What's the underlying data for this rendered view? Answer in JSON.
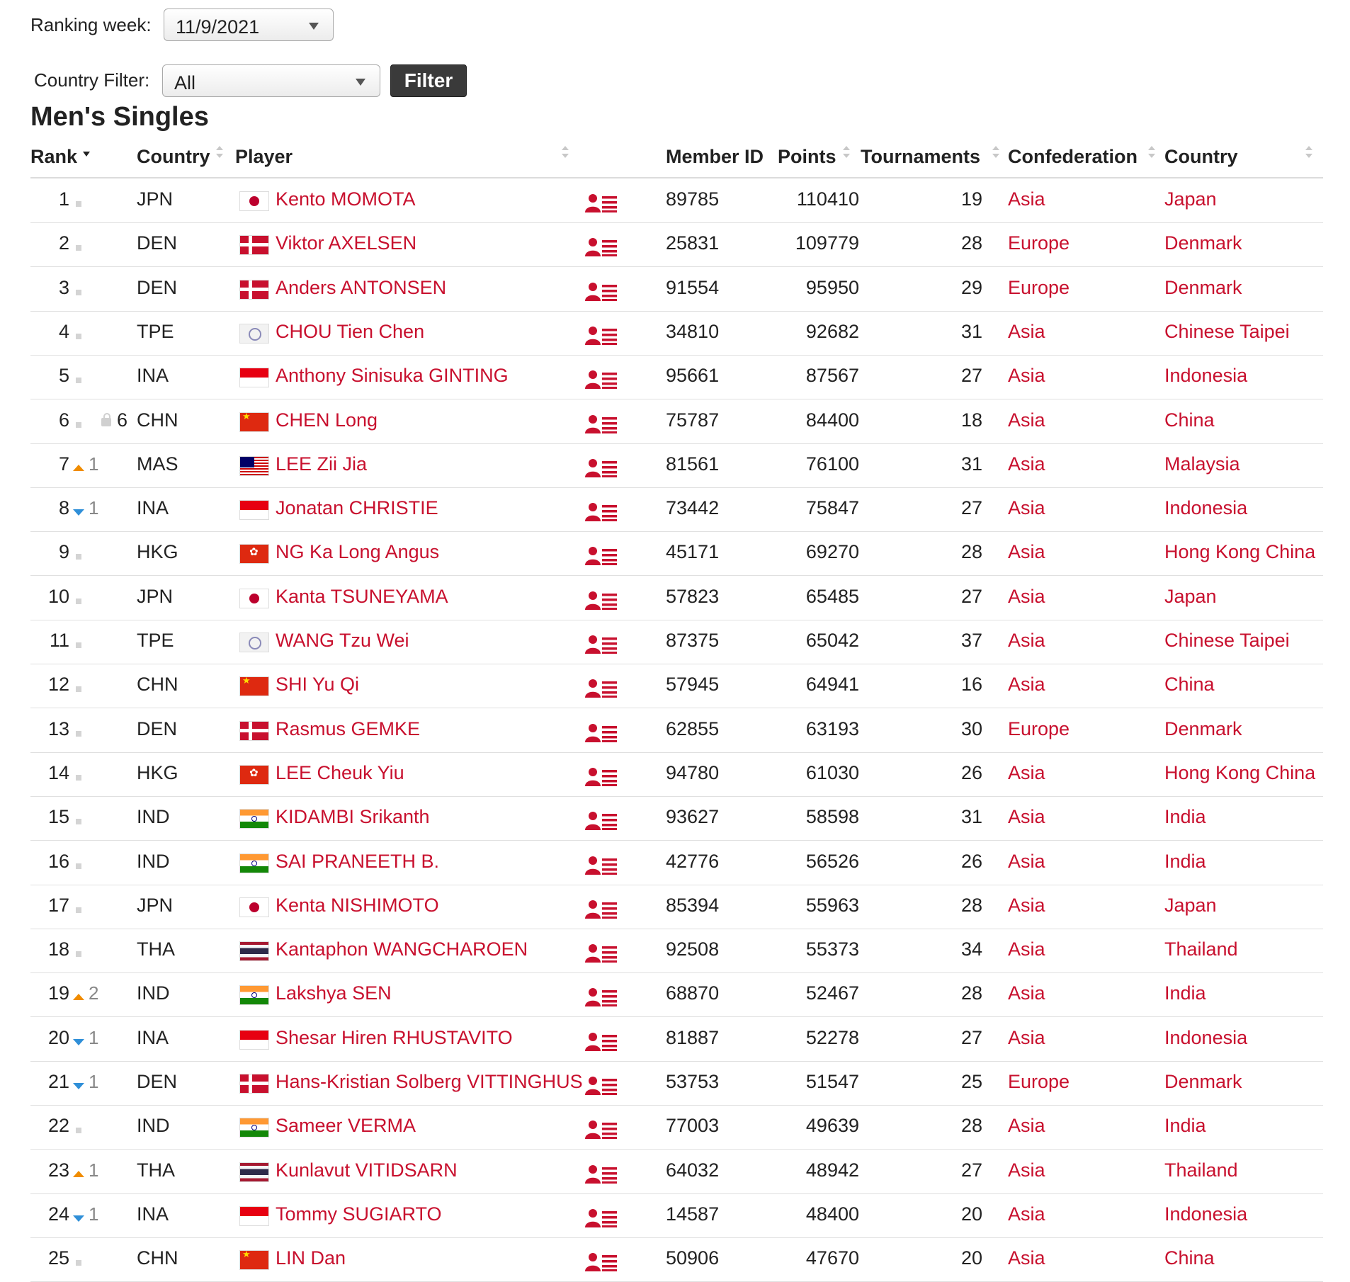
{
  "controls": {
    "ranking_week_label": "Ranking week:",
    "ranking_week_value": "11/9/2021",
    "country_filter_label": "Country Filter:",
    "country_filter_value": "All",
    "filter_button": "Filter"
  },
  "title": "Men's Singles",
  "columns": {
    "rank": "Rank",
    "country": "Country",
    "player": "Player",
    "member_id": "Member ID",
    "points": "Points",
    "tournaments": "Tournaments",
    "confederation": "Confederation",
    "country_name": "Country"
  },
  "icons": {
    "profile": "player-profile-icon",
    "colors": {
      "link": "#c8102e",
      "up": "#f08c00",
      "down": "#2f8fd8"
    }
  },
  "rows": [
    {
      "rank": "1",
      "move": "same",
      "change": "",
      "prev": "",
      "code": "JPN",
      "player": "Kento MOMOTA",
      "member_id": "89785",
      "points": "110410",
      "tournaments": "19",
      "confederation": "Asia",
      "country": "Japan"
    },
    {
      "rank": "2",
      "move": "same",
      "change": "",
      "prev": "",
      "code": "DEN",
      "player": "Viktor AXELSEN",
      "member_id": "25831",
      "points": "109779",
      "tournaments": "28",
      "confederation": "Europe",
      "country": "Denmark"
    },
    {
      "rank": "3",
      "move": "same",
      "change": "",
      "prev": "",
      "code": "DEN",
      "player": "Anders ANTONSEN",
      "member_id": "91554",
      "points": "95950",
      "tournaments": "29",
      "confederation": "Europe",
      "country": "Denmark"
    },
    {
      "rank": "4",
      "move": "same",
      "change": "",
      "prev": "",
      "code": "TPE",
      "player": "CHOU Tien Chen",
      "member_id": "34810",
      "points": "92682",
      "tournaments": "31",
      "confederation": "Asia",
      "country": "Chinese Taipei"
    },
    {
      "rank": "5",
      "move": "same",
      "change": "",
      "prev": "",
      "code": "INA",
      "player": "Anthony Sinisuka GINTING",
      "member_id": "95661",
      "points": "87567",
      "tournaments": "27",
      "confederation": "Asia",
      "country": "Indonesia"
    },
    {
      "rank": "6",
      "move": "same",
      "change": "",
      "prev": "6",
      "code": "CHN",
      "player": "CHEN Long",
      "member_id": "75787",
      "points": "84400",
      "tournaments": "18",
      "confederation": "Asia",
      "country": "China"
    },
    {
      "rank": "7",
      "move": "up",
      "change": "1",
      "prev": "",
      "code": "MAS",
      "player": "LEE Zii Jia",
      "member_id": "81561",
      "points": "76100",
      "tournaments": "31",
      "confederation": "Asia",
      "country": "Malaysia"
    },
    {
      "rank": "8",
      "move": "down",
      "change": "1",
      "prev": "",
      "code": "INA",
      "player": "Jonatan CHRISTIE",
      "member_id": "73442",
      "points": "75847",
      "tournaments": "27",
      "confederation": "Asia",
      "country": "Indonesia"
    },
    {
      "rank": "9",
      "move": "same",
      "change": "",
      "prev": "",
      "code": "HKG",
      "player": "NG Ka Long Angus",
      "member_id": "45171",
      "points": "69270",
      "tournaments": "28",
      "confederation": "Asia",
      "country": "Hong Kong China"
    },
    {
      "rank": "10",
      "move": "same",
      "change": "",
      "prev": "",
      "code": "JPN",
      "player": "Kanta TSUNEYAMA",
      "member_id": "57823",
      "points": "65485",
      "tournaments": "27",
      "confederation": "Asia",
      "country": "Japan"
    },
    {
      "rank": "11",
      "move": "same",
      "change": "",
      "prev": "",
      "code": "TPE",
      "player": "WANG Tzu Wei",
      "member_id": "87375",
      "points": "65042",
      "tournaments": "37",
      "confederation": "Asia",
      "country": "Chinese Taipei"
    },
    {
      "rank": "12",
      "move": "same",
      "change": "",
      "prev": "",
      "code": "CHN",
      "player": "SHI Yu Qi",
      "member_id": "57945",
      "points": "64941",
      "tournaments": "16",
      "confederation": "Asia",
      "country": "China"
    },
    {
      "rank": "13",
      "move": "same",
      "change": "",
      "prev": "",
      "code": "DEN",
      "player": "Rasmus GEMKE",
      "member_id": "62855",
      "points": "63193",
      "tournaments": "30",
      "confederation": "Europe",
      "country": "Denmark"
    },
    {
      "rank": "14",
      "move": "same",
      "change": "",
      "prev": "",
      "code": "HKG",
      "player": "LEE Cheuk Yiu",
      "member_id": "94780",
      "points": "61030",
      "tournaments": "26",
      "confederation": "Asia",
      "country": "Hong Kong China"
    },
    {
      "rank": "15",
      "move": "same",
      "change": "",
      "prev": "",
      "code": "IND",
      "player": "KIDAMBI Srikanth",
      "member_id": "93627",
      "points": "58598",
      "tournaments": "31",
      "confederation": "Asia",
      "country": "India"
    },
    {
      "rank": "16",
      "move": "same",
      "change": "",
      "prev": "",
      "code": "IND",
      "player": "SAI PRANEETH B.",
      "member_id": "42776",
      "points": "56526",
      "tournaments": "26",
      "confederation": "Asia",
      "country": "India"
    },
    {
      "rank": "17",
      "move": "same",
      "change": "",
      "prev": "",
      "code": "JPN",
      "player": "Kenta NISHIMOTO",
      "member_id": "85394",
      "points": "55963",
      "tournaments": "28",
      "confederation": "Asia",
      "country": "Japan"
    },
    {
      "rank": "18",
      "move": "same",
      "change": "",
      "prev": "",
      "code": "THA",
      "player": "Kantaphon WANGCHAROEN",
      "member_id": "92508",
      "points": "55373",
      "tournaments": "34",
      "confederation": "Asia",
      "country": "Thailand"
    },
    {
      "rank": "19",
      "move": "up",
      "change": "2",
      "prev": "",
      "code": "IND",
      "player": "Lakshya SEN",
      "member_id": "68870",
      "points": "52467",
      "tournaments": "28",
      "confederation": "Asia",
      "country": "India"
    },
    {
      "rank": "20",
      "move": "down",
      "change": "1",
      "prev": "",
      "code": "INA",
      "player": "Shesar Hiren RHUSTAVITO",
      "member_id": "81887",
      "points": "52278",
      "tournaments": "27",
      "confederation": "Asia",
      "country": "Indonesia"
    },
    {
      "rank": "21",
      "move": "down",
      "change": "1",
      "prev": "",
      "code": "DEN",
      "player": "Hans-Kristian Solberg VITTINGHUS",
      "member_id": "53753",
      "points": "51547",
      "tournaments": "25",
      "confederation": "Europe",
      "country": "Denmark"
    },
    {
      "rank": "22",
      "move": "same",
      "change": "",
      "prev": "",
      "code": "IND",
      "player": "Sameer VERMA",
      "member_id": "77003",
      "points": "49639",
      "tournaments": "28",
      "confederation": "Asia",
      "country": "India"
    },
    {
      "rank": "23",
      "move": "up",
      "change": "1",
      "prev": "",
      "code": "THA",
      "player": "Kunlavut VITIDSARN",
      "member_id": "64032",
      "points": "48942",
      "tournaments": "27",
      "confederation": "Asia",
      "country": "Thailand"
    },
    {
      "rank": "24",
      "move": "down",
      "change": "1",
      "prev": "",
      "code": "INA",
      "player": "Tommy SUGIARTO",
      "member_id": "14587",
      "points": "48400",
      "tournaments": "20",
      "confederation": "Asia",
      "country": "Indonesia"
    },
    {
      "rank": "25",
      "move": "same",
      "change": "",
      "prev": "",
      "code": "CHN",
      "player": "LIN Dan",
      "member_id": "50906",
      "points": "47670",
      "tournaments": "20",
      "confederation": "Asia",
      "country": "China"
    }
  ]
}
